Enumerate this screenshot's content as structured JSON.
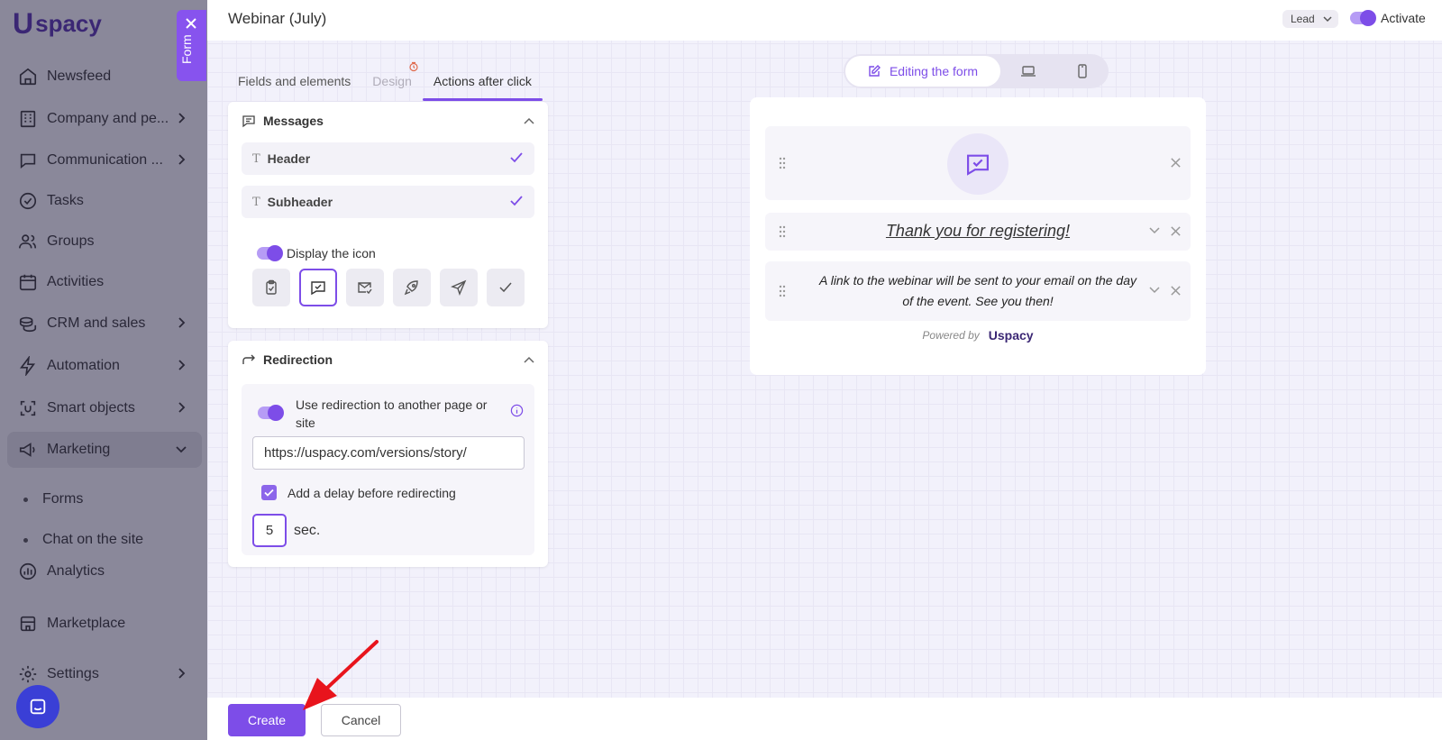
{
  "sidebar": {
    "logo_text": "spacy",
    "items": [
      {
        "label": "Newsfeed",
        "icon": "home-icon"
      },
      {
        "label": "Company and pe...",
        "icon": "building-icon",
        "has_chevron": true
      },
      {
        "label": "Communication ...",
        "icon": "chat-icon",
        "has_chevron": true
      },
      {
        "label": "Tasks",
        "icon": "check-circle-icon"
      },
      {
        "label": "Groups",
        "icon": "users-icon"
      },
      {
        "label": "Activities",
        "icon": "calendar-icon"
      },
      {
        "label": "CRM and sales",
        "icon": "coins-icon",
        "has_chevron": true
      },
      {
        "label": "Automation",
        "icon": "lightning-icon",
        "has_chevron": true
      },
      {
        "label": "Smart objects",
        "icon": "smart-object-icon",
        "has_chevron": true
      },
      {
        "label": "Marketing",
        "icon": "megaphone-icon",
        "has_chevron": true,
        "expanded": true
      },
      {
        "label": "Analytics",
        "icon": "chart-icon"
      },
      {
        "label": "Marketplace",
        "icon": "store-icon"
      },
      {
        "label": "Settings",
        "icon": "gear-icon",
        "has_chevron": true
      }
    ],
    "sub_items": [
      "Forms",
      "Chat on the site"
    ]
  },
  "form_tab": {
    "label": "Form"
  },
  "header": {
    "title": "Webinar (July)",
    "lead_select": "Lead",
    "activate_label": "Activate",
    "activate_on": true
  },
  "tabs": [
    {
      "label": "Fields and elements",
      "state": "normal"
    },
    {
      "label": "Design",
      "state": "disabled"
    },
    {
      "label": "Actions after click",
      "state": "active"
    }
  ],
  "messages": {
    "title": "Messages",
    "rows": [
      "Header",
      "Subheader"
    ],
    "display_icon_label": "Display the icon",
    "display_icon_on": true,
    "icon_options": [
      "clipboard-check-icon",
      "message-check-icon",
      "mail-check-icon",
      "rocket-icon",
      "send-icon",
      "check-icon"
    ],
    "selected_icon": "message-check-icon"
  },
  "redirection": {
    "title": "Redirection",
    "toggle_label": "Use redirection to another page or site",
    "toggle_on": true,
    "url": "https://uspacy.com/versions/story/",
    "delay_label": "Add a delay before redirecting",
    "delay_checked": true,
    "delay_value": "5",
    "delay_unit": "sec."
  },
  "preview": {
    "mode_label": "Editing the form",
    "thanks_text": "Thank you for registering!",
    "sub_text": "A link to the webinar will be sent to your email on the day of the event. See you then!",
    "powered_by": "Powered by",
    "powered_logo": "spacy"
  },
  "footer": {
    "create_label": "Create",
    "cancel_label": "Cancel"
  },
  "colors": {
    "accent": "#7d4de8",
    "sidebar_dim": "#8a889a"
  }
}
